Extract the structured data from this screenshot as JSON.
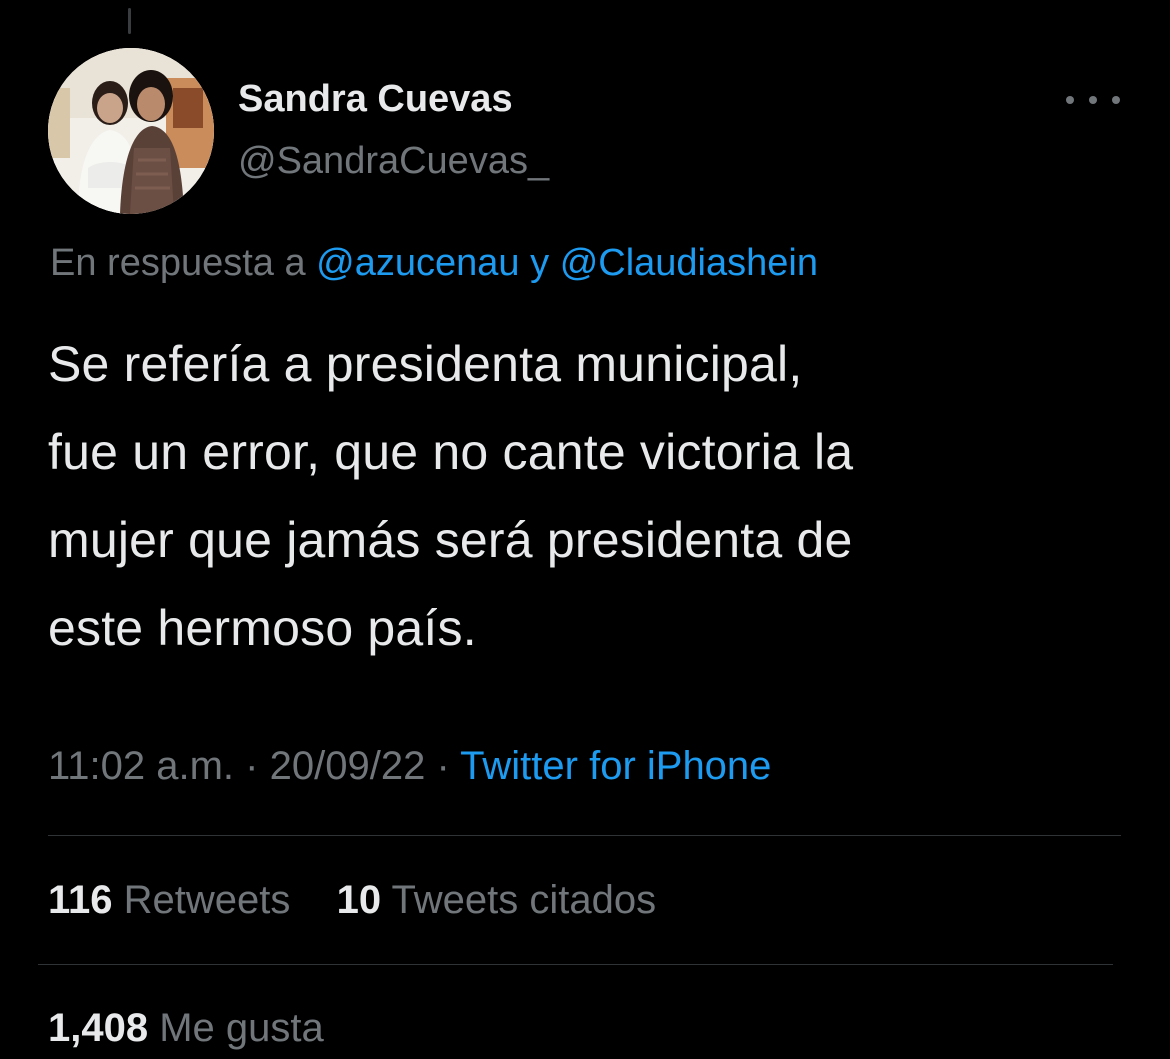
{
  "author": {
    "display_name": "Sandra Cuevas",
    "handle": "@SandraCuevas_"
  },
  "reply_context": {
    "prefix": "En respuesta a",
    "mention_1": "@azucenau",
    "conjunction": "y",
    "mention_2": "@Claudiashein"
  },
  "tweet": {
    "text": "Se refería a presidenta municipal,\nfue un error, que no cante victoria la\nmujer que jamás será presidenta de\neste hermoso país."
  },
  "meta": {
    "time": "11:02 a.m.",
    "separator": "·",
    "date": "20/09/22",
    "source": "Twitter for iPhone"
  },
  "stats": {
    "retweets_count": "116",
    "retweets_label": "Retweets",
    "quotes_count": "10",
    "quotes_label": "Tweets citados",
    "likes_count": "1,408",
    "likes_label": "Me gusta"
  },
  "icons": {
    "more": "more-horizontal-icon"
  },
  "colors": {
    "background": "#000000",
    "primary_text": "#e7e9ea",
    "secondary_text": "#71767b",
    "link": "#1d9bf0",
    "divider": "#2f3336"
  }
}
